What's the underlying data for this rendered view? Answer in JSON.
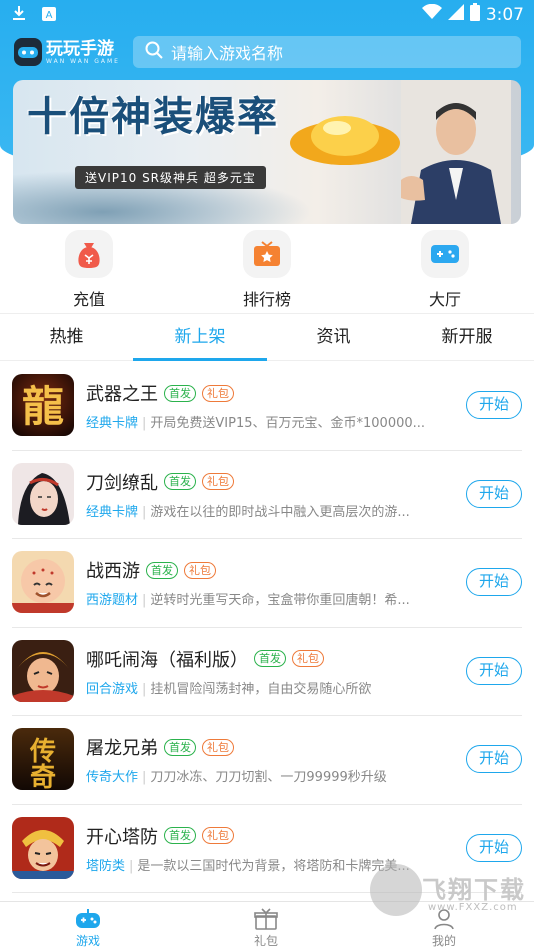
{
  "status_bar": {
    "time": "3:07"
  },
  "header": {
    "logo_title": "玩玩手游",
    "logo_sub": "WAN WAN GAME",
    "search_placeholder": "请输入游戏名称"
  },
  "banner": {
    "title": "十倍神装爆率",
    "subtitle": "送VIP10 SR级神兵  超多元宝"
  },
  "quick_links": [
    {
      "label": "充值",
      "icon": "money-bag-icon",
      "color": "#f05a4a"
    },
    {
      "label": "排行榜",
      "icon": "ranking-icon",
      "color": "#f58232"
    },
    {
      "label": "大厅",
      "icon": "gamepad-icon",
      "color": "#2ca8f0"
    }
  ],
  "tabs": [
    {
      "label": "热推"
    },
    {
      "label": "新上架"
    },
    {
      "label": "资讯"
    },
    {
      "label": "新开服"
    }
  ],
  "active_tab_index": 1,
  "tag_labels": {
    "first": "首发",
    "gift": "礼包"
  },
  "start_label": "开始",
  "games": [
    {
      "name": "武器之王",
      "category": "经典卡牌",
      "desc": "开局免费送VIP15、百万元宝、金币*100000...",
      "icon": "dragon-calligraphy-icon"
    },
    {
      "name": "刀剑缭乱",
      "category": "经典卡牌",
      "desc": "游戏在以往的即时战斗中融入更高层次的游...",
      "icon": "swordswoman-portrait-icon"
    },
    {
      "name": "战西游",
      "category": "西游题材",
      "desc": "逆转时光重写天命，宝盒带你重回唐朝！希...",
      "icon": "bald-monk-portrait-icon"
    },
    {
      "name": "哪吒闹海（福利版）",
      "category": "回合游戏",
      "desc": "挂机冒险闯荡封神，自由交易随心所欲",
      "icon": "nezha-portrait-icon"
    },
    {
      "name": "屠龙兄弟",
      "category": "传奇大作",
      "desc": "刀刀冰冻、刀刀切割、一刀99999秒升级",
      "icon": "legend-calligraphy-icon"
    },
    {
      "name": "开心塔防",
      "category": "塔防类",
      "desc": "是一款以三国时代为背景，将塔防和卡牌完美...",
      "icon": "warrior-portrait-icon"
    }
  ],
  "bottom_nav": [
    {
      "label": "游戏",
      "icon": "gamepad-icon"
    },
    {
      "label": "礼包",
      "icon": "gift-icon"
    },
    {
      "label": "我的",
      "icon": "user-icon"
    }
  ],
  "watermark": {
    "text": "飞翔下载",
    "url": "www.FXXZ.com"
  },
  "colors": {
    "accent": "#1ea7ec",
    "first_tag": "#2bb24c",
    "gift_tag": "#ee7a3a"
  }
}
